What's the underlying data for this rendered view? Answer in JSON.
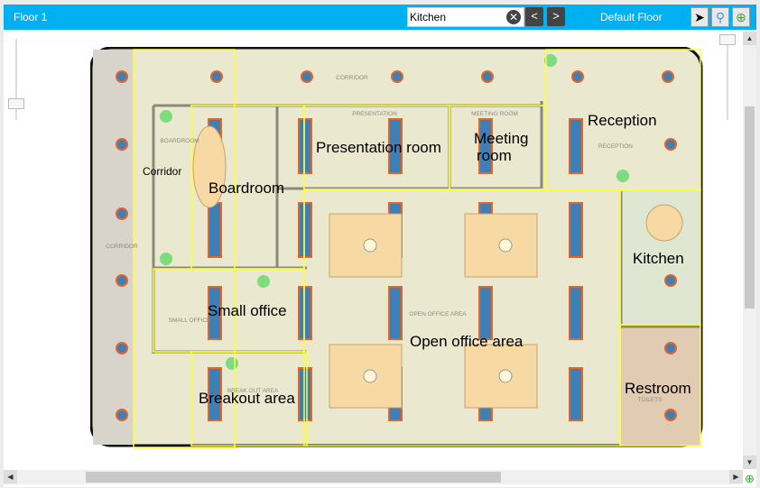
{
  "header": {
    "title": "Floor 1",
    "search_value": "Kitchen",
    "floor_name": "Default Floor",
    "prev": "<",
    "next": ">",
    "clear": "✕"
  },
  "tools": [
    {
      "name": "select",
      "icon": "pointer-icon"
    },
    {
      "name": "zoom",
      "icon": "magnifier-icon"
    },
    {
      "name": "locate",
      "icon": "crosshair-icon"
    }
  ],
  "zones": [
    "Corridor",
    "Boardroom",
    "Presentation room",
    "Meeting room",
    "Reception",
    "Kitchen",
    "Small office",
    "Open office area",
    "Breakout area",
    "Restroom"
  ],
  "map_labels": [
    "CORRIDOR",
    "BOARDROOM",
    "PRESENTATION",
    "MEETING ROOM",
    "RECEPTION",
    "CORRIDOR",
    "SMALL OFFICE",
    "OPEN OFFICE AREA",
    "BREAK OUT AREA",
    "TOILETS"
  ],
  "colors": {
    "header": "#00b0f0",
    "zone_outline": "#ffff33",
    "floor": "#ebe8d0",
    "column": "#3f7fb5"
  }
}
